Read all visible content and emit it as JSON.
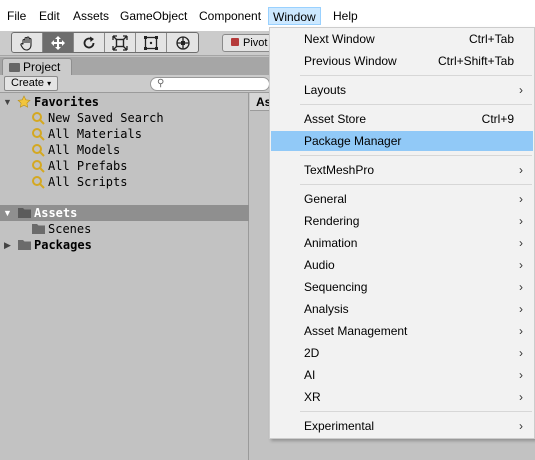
{
  "menubar": {
    "items": [
      {
        "label": "File"
      },
      {
        "label": "Edit"
      },
      {
        "label": "Assets"
      },
      {
        "label": "GameObject"
      },
      {
        "label": "Component"
      },
      {
        "label": "Window",
        "active": true
      },
      {
        "label": "Help"
      }
    ]
  },
  "toolbar": {
    "tools": [
      "hand-tool-icon",
      "move-tool-icon",
      "rotate-tool-icon",
      "scale-tool-icon",
      "rect-tool-icon",
      "transform-tool-icon"
    ],
    "pivot_label": "Pivot"
  },
  "project": {
    "tab_label": "Project",
    "create_label": "Create",
    "search_placeholder": "",
    "right_header": "Assets",
    "favorites_label": "Favorites",
    "favorites": [
      "New Saved Search",
      "All Materials",
      "All Models",
      "All Prefabs",
      "All Scripts"
    ],
    "assets_label": "Assets",
    "scenes_label": "Scenes",
    "packages_label": "Packages"
  },
  "window_menu": {
    "groups": [
      [
        {
          "label": "Next Window",
          "shortcut": "Ctrl+Tab"
        },
        {
          "label": "Previous Window",
          "shortcut": "Ctrl+Shift+Tab"
        }
      ],
      [
        {
          "label": "Layouts",
          "submenu": true
        }
      ],
      [
        {
          "label": "Asset Store",
          "shortcut": "Ctrl+9"
        },
        {
          "label": "Package Manager",
          "highlighted": true
        }
      ],
      [
        {
          "label": "TextMeshPro",
          "submenu": true
        }
      ],
      [
        {
          "label": "General",
          "submenu": true
        },
        {
          "label": "Rendering",
          "submenu": true
        },
        {
          "label": "Animation",
          "submenu": true
        },
        {
          "label": "Audio",
          "submenu": true
        },
        {
          "label": "Sequencing",
          "submenu": true
        },
        {
          "label": "Analysis",
          "submenu": true
        },
        {
          "label": "Asset Management",
          "submenu": true
        },
        {
          "label": "2D",
          "submenu": true
        },
        {
          "label": "AI",
          "submenu": true
        },
        {
          "label": "XR",
          "submenu": true
        }
      ],
      [
        {
          "label": "Experimental",
          "submenu": true
        }
      ]
    ],
    "submenu_arrow": "›"
  },
  "colors": {
    "menu_highlight": "#91c9f7",
    "window_active": "#cce8ff",
    "selection_row": "#8f8f8f"
  }
}
